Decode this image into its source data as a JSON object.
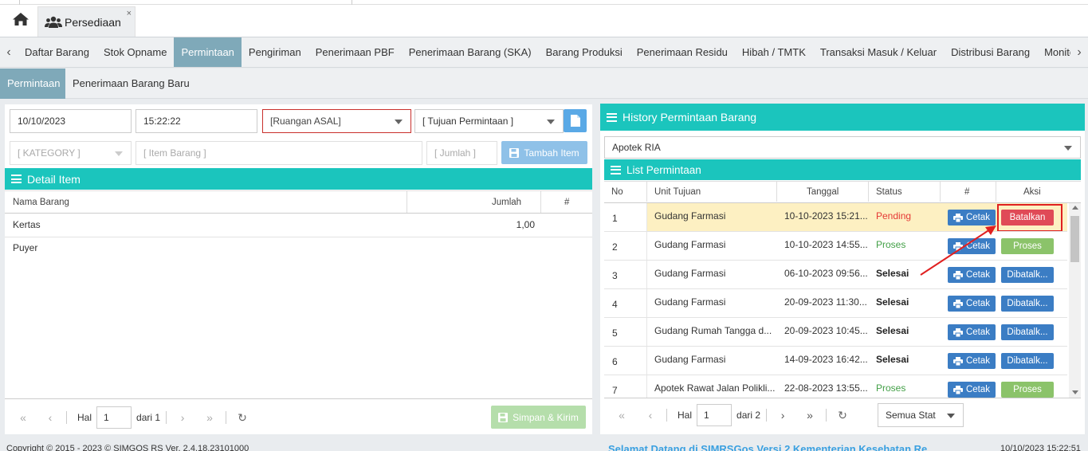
{
  "tabs": {
    "home_icon": "home-icon",
    "active_tab": "Persediaan",
    "close": "×"
  },
  "menu": {
    "items": [
      "Daftar Barang",
      "Stok Opname",
      "Permintaan",
      "Pengiriman",
      "Penerimaan PBF",
      "Penerimaan Barang (SKA)",
      "Barang Produksi",
      "Penerimaan Residu",
      "Hibah / TMTK",
      "Transaksi Masuk / Keluar",
      "Distribusi Barang",
      "Monitoring",
      "Moni"
    ],
    "active": "Permintaan",
    "left_arrow": "‹",
    "right_arrow": "›"
  },
  "submenu": {
    "items": [
      "Permintaan",
      "Penerimaan Barang Baru"
    ],
    "active": "Permintaan"
  },
  "form": {
    "date": "10/10/2023",
    "time": "15:22:22",
    "ruangan_asal": "[Ruangan ASAL]",
    "tujuan": "[ Tujuan Permintaan ]",
    "category": "[ KATEGORY ]",
    "item_barang": "[ Item Barang ]",
    "jumlah": "[ Jumlah ]",
    "tambah_label": "Tambah Item"
  },
  "detail": {
    "title": "Detail Item",
    "col_nama": "Nama Barang",
    "col_jumlah": "Jumlah",
    "col_hash": "#",
    "rows": [
      {
        "nama": "Kertas Puyer",
        "jumlah": "1,00"
      }
    ]
  },
  "left_pager": {
    "hal": "Hal",
    "page": "1",
    "dari": "dari 1",
    "simpan": "Simpan & Kirim"
  },
  "history": {
    "title": "History Permintaan Barang",
    "apotek": "Apotek RIA",
    "list_title": "List Permintaan",
    "cols": {
      "no": "No",
      "unit": "Unit Tujuan",
      "tanggal": "Tanggal",
      "status": "Status",
      "hash": "#",
      "aksi": "Aksi"
    },
    "rows": [
      {
        "no": "1",
        "unit": "Gudang Farmasi",
        "tanggal": "10-10-2023 15:21...",
        "status": "Pending",
        "cetak": "Cetak",
        "aksi": "Batalkan",
        "aksi_type": "red"
      },
      {
        "no": "2",
        "unit": "Gudang Farmasi",
        "tanggal": "10-10-2023 14:55...",
        "status": "Proses",
        "cetak": "Cetak",
        "aksi": "Proses",
        "aksi_type": "green"
      },
      {
        "no": "3",
        "unit": "Gudang Farmasi",
        "tanggal": "06-10-2023 09:56...",
        "status": "Selesai",
        "cetak": "Cetak",
        "aksi": "Dibatalk...",
        "aksi_type": "blue"
      },
      {
        "no": "4",
        "unit": "Gudang Farmasi",
        "tanggal": "20-09-2023 11:30...",
        "status": "Selesai",
        "cetak": "Cetak",
        "aksi": "Dibatalk...",
        "aksi_type": "blue"
      },
      {
        "no": "5",
        "unit": "Gudang Rumah Tangga d...",
        "tanggal": "20-09-2023 10:45...",
        "status": "Selesai",
        "cetak": "Cetak",
        "aksi": "Dibatalk...",
        "aksi_type": "blue"
      },
      {
        "no": "6",
        "unit": "Gudang Farmasi",
        "tanggal": "14-09-2023 16:42...",
        "status": "Selesai",
        "cetak": "Cetak",
        "aksi": "Dibatalk...",
        "aksi_type": "blue"
      },
      {
        "no": "7",
        "unit": "Apotek Rawat Jalan Polikli...",
        "tanggal": "22-08-2023 13:55...",
        "status": "Proses",
        "cetak": "Cetak",
        "aksi": "Proses",
        "aksi_type": "green"
      }
    ],
    "pager": {
      "hal": "Hal",
      "page": "1",
      "dari": "dari 2",
      "filter": "Semua Stat"
    }
  },
  "footer": {
    "copyright": "Copyright © 2015 - 2023 © SIMGOS RS Ver. 2.4.18.23101000",
    "welcome": "Selamat Datang di SIMRSGos Versi 2 Kementerian Kesehatan Re",
    "datetime": "10/10/2023 15:22:51"
  },
  "colors": {
    "accent": "#1bc5bd",
    "active_tab": "#7fa9b9",
    "red": "#e04a57",
    "green": "#8bc36a",
    "blue": "#3b7dc4"
  }
}
